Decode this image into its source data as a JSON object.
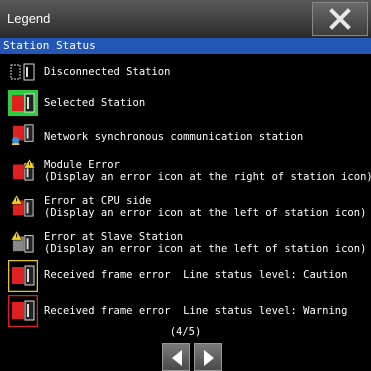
{
  "window": {
    "title": "Legend"
  },
  "section": {
    "label": "Station Status"
  },
  "items": [
    {
      "line1": "Disconnected Station"
    },
    {
      "line1": "Selected Station"
    },
    {
      "line1": "Network synchronous communication station"
    },
    {
      "line1": "Module Error",
      "line2": "(Display an error icon at the right of station icon)"
    },
    {
      "line1": "Error at CPU side",
      "line2": "(Display an error icon at the left of station icon)"
    },
    {
      "line1": "Error at Slave Station",
      "line2": "(Display an error icon at the left of station icon)"
    },
    {
      "line1": "Received frame error  Line status level: Caution"
    },
    {
      "line1": "Received frame error  Line status level: Warning"
    }
  ],
  "pagination": {
    "label": "(4/5)"
  },
  "colors": {
    "selected_highlight": "#2ecc40",
    "caution_border": "#e6c619",
    "warning_border": "#e02020",
    "section_bg": "#2456b6"
  }
}
